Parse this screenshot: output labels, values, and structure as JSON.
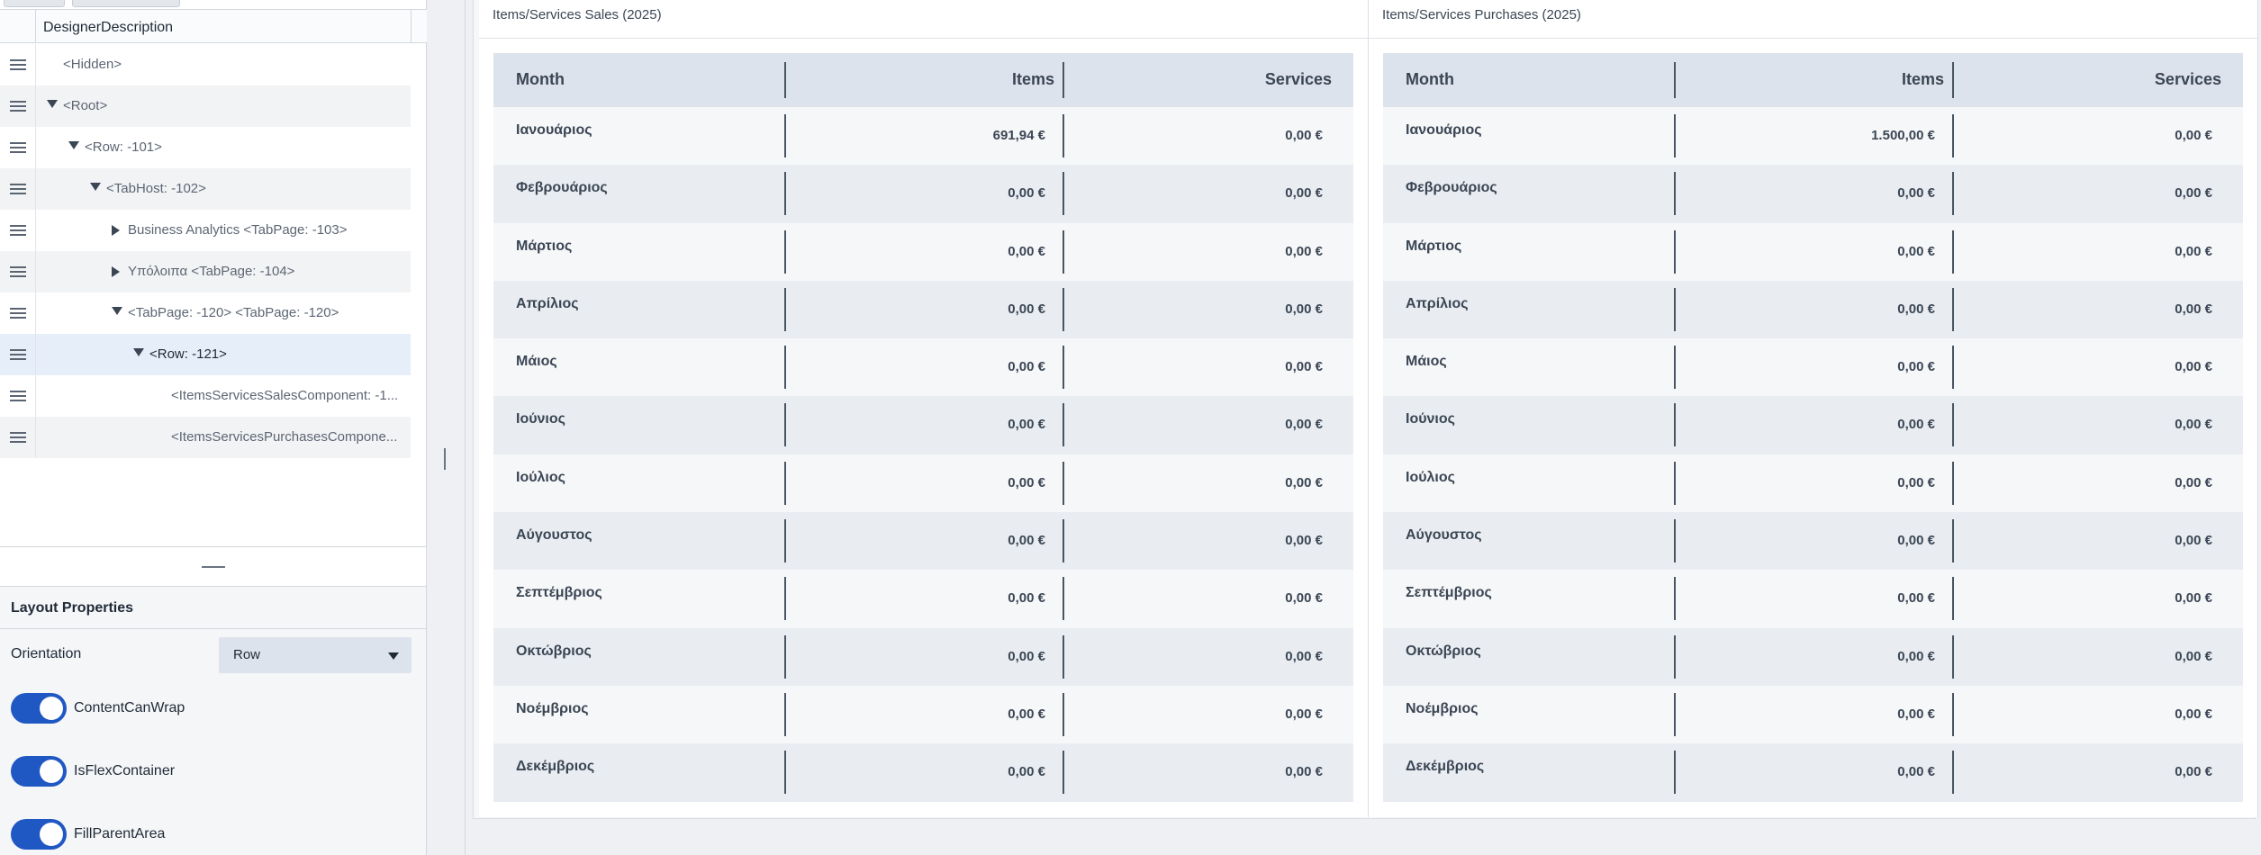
{
  "tree": {
    "header": "DesignerDescription",
    "rows": [
      {
        "label": "<Hidden>",
        "indent": 0,
        "arrow": "none"
      },
      {
        "label": "<Root>",
        "indent": 0,
        "arrow": "down"
      },
      {
        "label": "<Row: -101>",
        "indent": 1,
        "arrow": "down"
      },
      {
        "label": "<TabHost: -102>",
        "indent": 2,
        "arrow": "down"
      },
      {
        "label": "Business Analytics <TabPage: -103>",
        "indent": 3,
        "arrow": "right"
      },
      {
        "label": "Υπόλοιπα <TabPage: -104>",
        "indent": 3,
        "arrow": "right"
      },
      {
        "label": "<TabPage: -120> <TabPage: -120>",
        "indent": 3,
        "arrow": "down"
      },
      {
        "label": "<Row: -121>",
        "indent": 4,
        "arrow": "down",
        "selected": true
      },
      {
        "label": "<ItemsServicesSalesComponent: -1...",
        "indent": 5,
        "arrow": "none"
      },
      {
        "label": "<ItemsServicesPurchasesCompone...",
        "indent": 5,
        "arrow": "none"
      }
    ]
  },
  "layout_properties": {
    "title": "Layout Properties",
    "orientation_label": "Orientation",
    "orientation_value": "Row",
    "toggles": [
      {
        "label": "ContentCanWrap",
        "on": true
      },
      {
        "label": "IsFlexContainer",
        "on": true
      },
      {
        "label": "FillParentArea",
        "on": true
      }
    ]
  },
  "sales": {
    "title": "Items/Services Sales (2025)",
    "columns": [
      "Month",
      "Items",
      "Services"
    ],
    "rows": [
      [
        "Ιανουάριος",
        "691,94 €",
        "0,00 €"
      ],
      [
        "Φεβρουάριος",
        "0,00 €",
        "0,00 €"
      ],
      [
        "Μάρτιος",
        "0,00 €",
        "0,00 €"
      ],
      [
        "Απρίλιος",
        "0,00 €",
        "0,00 €"
      ],
      [
        "Μάιος",
        "0,00 €",
        "0,00 €"
      ],
      [
        "Ιούνιος",
        "0,00 €",
        "0,00 €"
      ],
      [
        "Ιούλιος",
        "0,00 €",
        "0,00 €"
      ],
      [
        "Αύγουστος",
        "0,00 €",
        "0,00 €"
      ],
      [
        "Σεπτέμβριος",
        "0,00 €",
        "0,00 €"
      ],
      [
        "Οκτώβριος",
        "0,00 €",
        "0,00 €"
      ],
      [
        "Νοέμβριος",
        "0,00 €",
        "0,00 €"
      ],
      [
        "Δεκέμβριος",
        "0,00 €",
        "0,00 €"
      ]
    ]
  },
  "purchases": {
    "title": "Items/Services Purchases (2025)",
    "columns": [
      "Month",
      "Items",
      "Services"
    ],
    "rows": [
      [
        "Ιανουάριος",
        "1.500,00 €",
        "0,00 €"
      ],
      [
        "Φεβρουάριος",
        "0,00 €",
        "0,00 €"
      ],
      [
        "Μάρτιος",
        "0,00 €",
        "0,00 €"
      ],
      [
        "Απρίλιος",
        "0,00 €",
        "0,00 €"
      ],
      [
        "Μάιος",
        "0,00 €",
        "0,00 €"
      ],
      [
        "Ιούνιος",
        "0,00 €",
        "0,00 €"
      ],
      [
        "Ιούλιος",
        "0,00 €",
        "0,00 €"
      ],
      [
        "Αύγουστος",
        "0,00 €",
        "0,00 €"
      ],
      [
        "Σεπτέμβριος",
        "0,00 €",
        "0,00 €"
      ],
      [
        "Οκτώβριος",
        "0,00 €",
        "0,00 €"
      ],
      [
        "Νοέμβριος",
        "0,00 €",
        "0,00 €"
      ],
      [
        "Δεκέμβριος",
        "0,00 €",
        "0,00 €"
      ]
    ]
  },
  "colors": {
    "accent": "#1f57c3",
    "header_bg": "#dde3ec",
    "row_alt": "#e9edf2",
    "selected_row": "#e6eef9"
  }
}
